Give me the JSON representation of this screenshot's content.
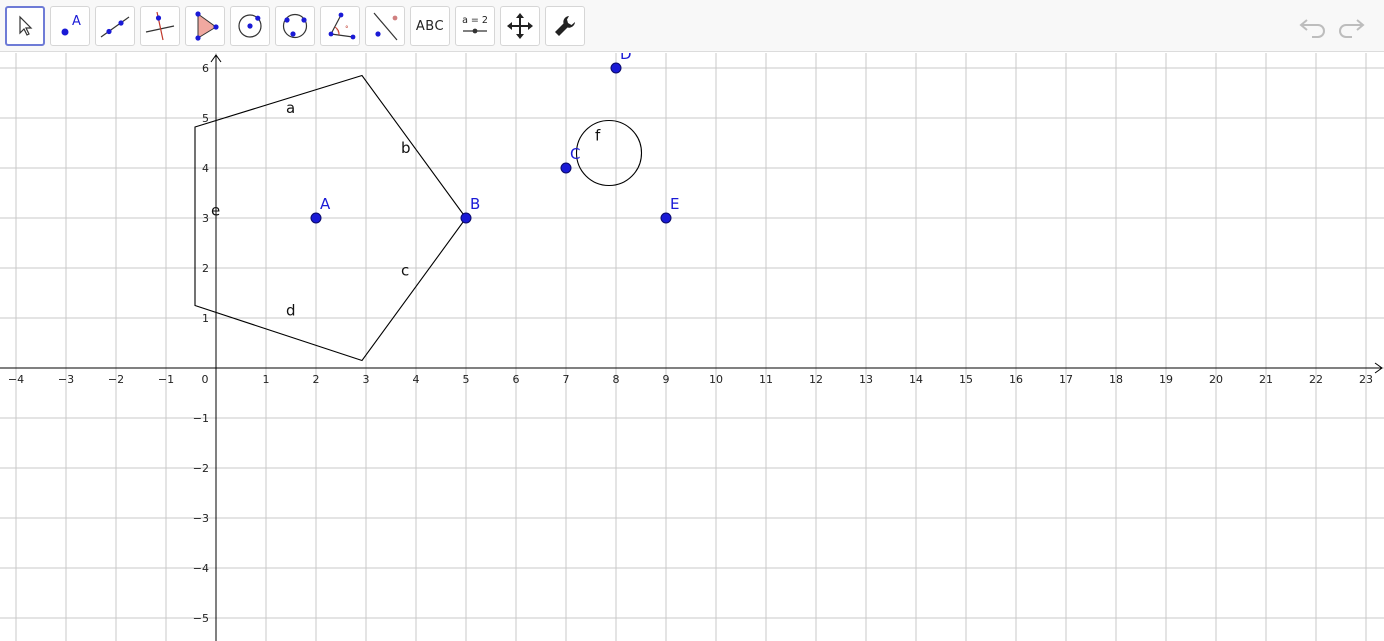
{
  "toolbar": {
    "tools": [
      {
        "id": "move",
        "icon": "cursor-arrow-icon",
        "selected": true
      },
      {
        "id": "point",
        "icon": "point-icon",
        "label": "A"
      },
      {
        "id": "line",
        "icon": "line-through-points-icon"
      },
      {
        "id": "perpendicular",
        "icon": "perpendicular-line-icon"
      },
      {
        "id": "polygon",
        "icon": "polygon-icon"
      },
      {
        "id": "circle",
        "icon": "circle-center-point-icon"
      },
      {
        "id": "circle-three",
        "icon": "circle-three-points-icon"
      },
      {
        "id": "angle",
        "icon": "angle-icon"
      },
      {
        "id": "reflect",
        "icon": "reflect-about-line-icon"
      },
      {
        "id": "text",
        "icon": "text-icon",
        "label": "ABC"
      },
      {
        "id": "slider",
        "icon": "slider-icon",
        "label": "a = 2"
      },
      {
        "id": "move-graphics",
        "icon": "move-graphics-view-icon"
      },
      {
        "id": "settings",
        "icon": "wrench-icon"
      }
    ],
    "undo_icon": "undo-icon",
    "redo_icon": "redo-icon"
  },
  "colors": {
    "point": "#1a1ad6",
    "label": "#1a1ad6",
    "grid": "#c8c8c8",
    "axis": "#000000"
  },
  "graph": {
    "x_range": [
      -4,
      23
    ],
    "y_range": [
      -5,
      6
    ],
    "x_ticks": [
      "−4",
      "−3",
      "−2",
      "−1",
      "0",
      "1",
      "2",
      "3",
      "4",
      "5",
      "6",
      "7",
      "8",
      "9",
      "10",
      "11",
      "12",
      "13",
      "14",
      "15",
      "16",
      "17",
      "18",
      "19",
      "20",
      "21",
      "22",
      "23"
    ],
    "y_ticks_pos": [
      "1",
      "2",
      "3",
      "4",
      "5",
      "6"
    ],
    "y_ticks_neg": [
      "−1",
      "−2",
      "−3",
      "−4",
      "−5"
    ],
    "pentagon": [
      [
        -0.42,
        4.82
      ],
      [
        2.92,
        5.85
      ],
      [
        5,
        3
      ],
      [
        2.92,
        0.15
      ],
      [
        -0.42,
        1.25
      ]
    ],
    "segments": [
      {
        "name": "a",
        "at": [
          1.4,
          5.1
        ]
      },
      {
        "name": "b",
        "at": [
          3.7,
          4.3
        ]
      },
      {
        "name": "c",
        "at": [
          3.7,
          1.85
        ]
      },
      {
        "name": "d",
        "at": [
          1.4,
          1.05
        ]
      },
      {
        "name": "e",
        "at": [
          -0.1,
          3.05
        ]
      }
    ],
    "points": [
      {
        "name": "A",
        "x": 2,
        "y": 3
      },
      {
        "name": "B",
        "x": 5,
        "y": 3
      },
      {
        "name": "C",
        "x": 7,
        "y": 4
      },
      {
        "name": "D",
        "x": 8,
        "y": 6
      },
      {
        "name": "E",
        "x": 9,
        "y": 3
      }
    ],
    "circle": {
      "name": "f",
      "cx": 7.86,
      "cy": 4.3,
      "r": 0.65,
      "label_at": [
        7.58,
        4.55
      ]
    }
  }
}
